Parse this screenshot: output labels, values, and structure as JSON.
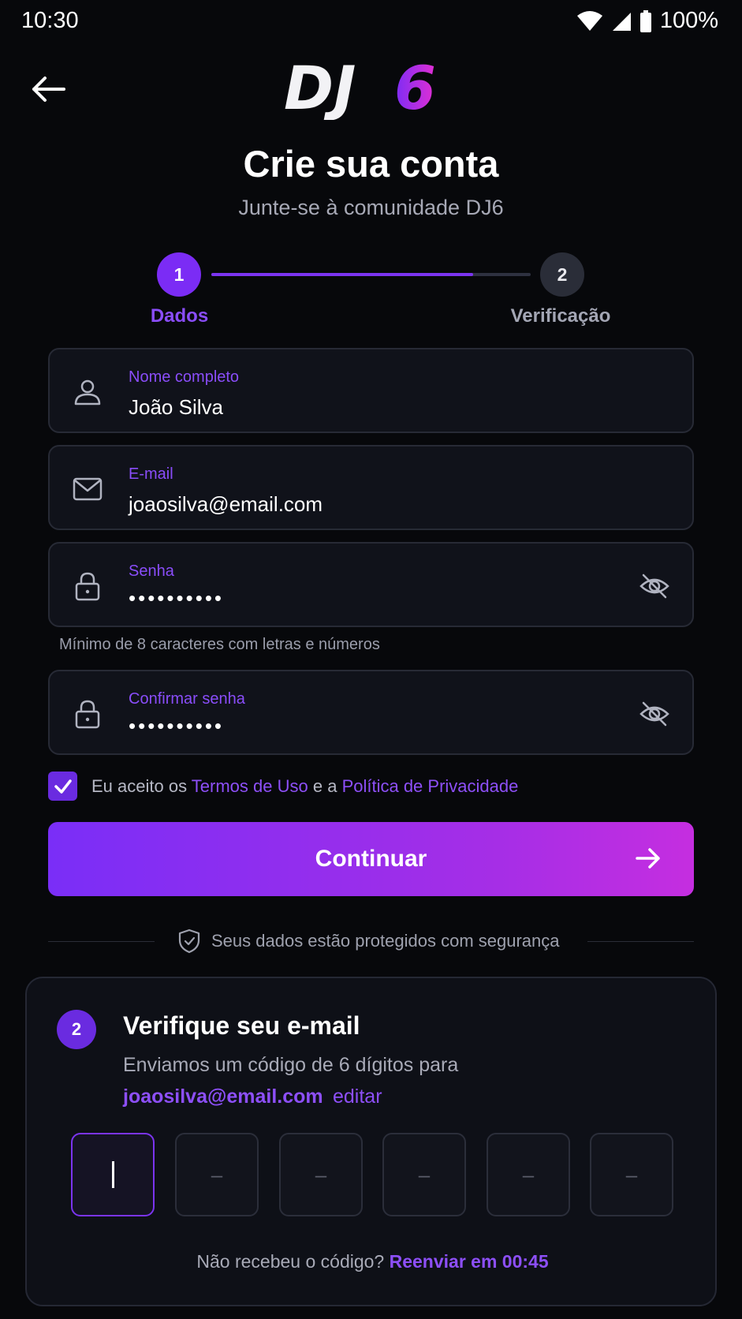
{
  "status_bar": {
    "time": "10:30",
    "battery": "100%",
    "icons": [
      "wifi-icon",
      "signal-icon",
      "battery-icon"
    ]
  },
  "header": {
    "back_icon": "arrow-left-icon",
    "logo_text": "DJ6",
    "title": "Crie sua conta",
    "subtitle": "Junte-se à comunidade DJ6"
  },
  "stepper": {
    "steps": [
      {
        "number": "1",
        "label": "Dados",
        "active": true
      },
      {
        "number": "2",
        "label": "Verificação",
        "active": false
      }
    ],
    "progress_fraction": 0.82
  },
  "form": {
    "full_name": {
      "label": "Nome completo",
      "value": "João Silva",
      "icon": "user-icon"
    },
    "email": {
      "label": "E-mail",
      "value": "joaosilva@email.com",
      "icon": "mail-icon"
    },
    "password": {
      "label": "Senha",
      "value": "••••••••••",
      "icon": "lock-icon",
      "toggle_icon": "eye-off-icon"
    },
    "password_hint": "Mínimo de 8 caracteres com letras e números",
    "confirm_password": {
      "label": "Confirmar senha",
      "value": "••••••••••",
      "icon": "lock-icon",
      "toggle_icon": "eye-off-icon"
    },
    "terms": {
      "checked": true,
      "prefix": "Eu aceito os ",
      "terms_link": "Termos de Uso",
      "middle": " e a ",
      "privacy_link": "Política de Privacidade"
    },
    "continue_label": "Continuar",
    "security_note": "Seus dados estão protegidos com segurança"
  },
  "verification": {
    "step_number": "2",
    "title": "Verifique seu e-mail",
    "description": "Enviamos um código de 6 dígitos para",
    "email": "joaosilva@email.com",
    "edit_label": "editar",
    "otp_placeholder": "–",
    "resend_prefix": "Não recebeu o código? ",
    "resend_link": "Reenviar em 00:45"
  },
  "colors": {
    "accent": "#7b2cf5",
    "gradient_end": "#c52ee0",
    "background": "#07080b",
    "field_bg": "#10121a"
  }
}
